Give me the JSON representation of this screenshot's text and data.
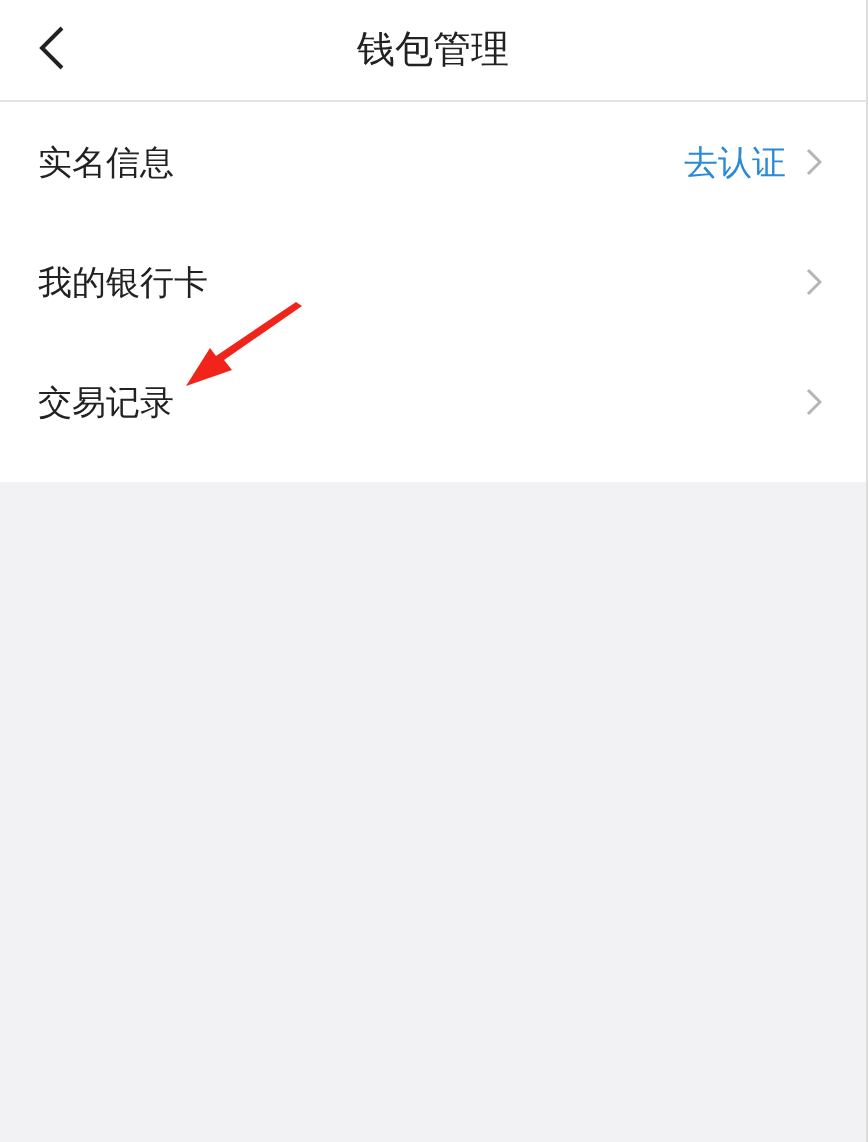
{
  "header": {
    "title": "钱包管理"
  },
  "menu": [
    {
      "label": "实名信息",
      "value": "去认证"
    },
    {
      "label": "我的银行卡"
    },
    {
      "label": "交易记录"
    }
  ]
}
